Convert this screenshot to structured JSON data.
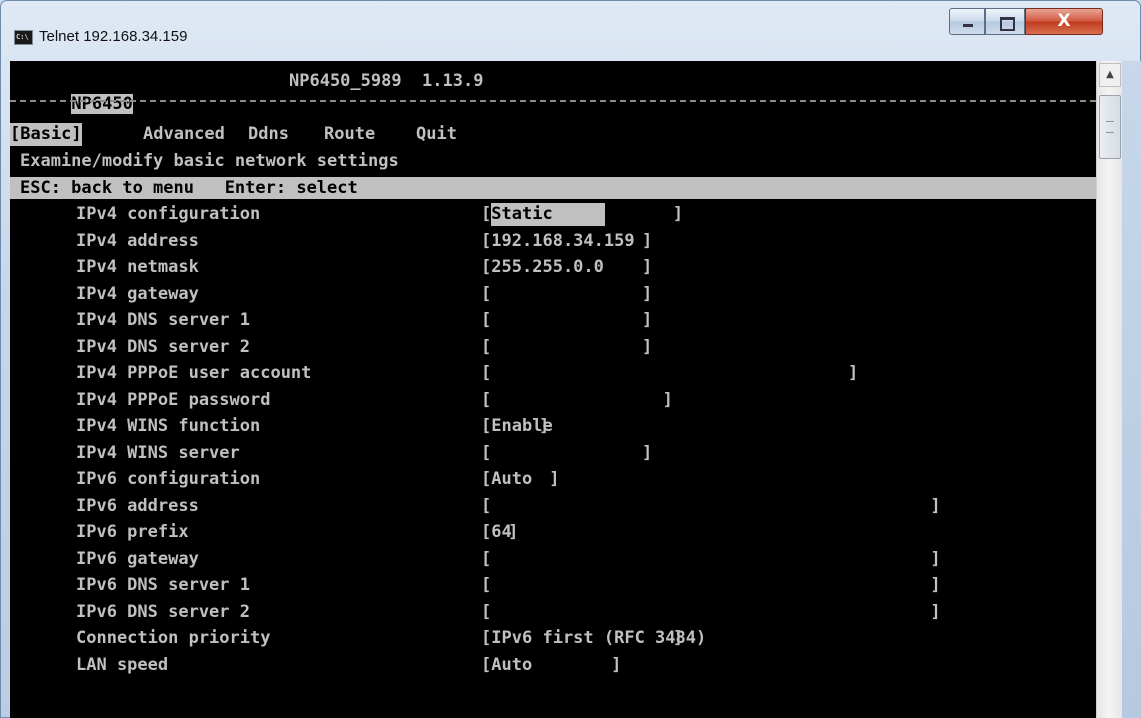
{
  "window": {
    "title": "Telnet 192.168.34.159",
    "icon_label": "C:\\",
    "close_symbol": "X"
  },
  "header": {
    "model": "NP6450",
    "name_version": "NP6450_5989  1.13.9"
  },
  "menu": {
    "items": [
      {
        "label": "[Basic]",
        "selected": true
      },
      {
        "label": "Advanced",
        "selected": false
      },
      {
        "label": "Ddns",
        "selected": false
      },
      {
        "label": "Route",
        "selected": false
      },
      {
        "label": "Quit",
        "selected": false
      }
    ],
    "description": "Examine/modify basic network settings"
  },
  "status": {
    "text": "ESC: back to menu   Enter: select"
  },
  "settings": [
    {
      "label": "IPv4 configuration",
      "value": "Static",
      "close_col": 63
    },
    {
      "label": "IPv4 address",
      "value": "192.168.34.159 ",
      "close_col": 60
    },
    {
      "label": "IPv4 netmask",
      "value": "255.255.0.0",
      "close_col": 60
    },
    {
      "label": "IPv4 gateway",
      "value": "",
      "close_col": 60
    },
    {
      "label": "IPv4 DNS server 1",
      "value": "",
      "close_col": 60
    },
    {
      "label": "IPv4 DNS server 2",
      "value": "",
      "close_col": 60
    },
    {
      "label": "IPv4 PPPoE user account",
      "value": "",
      "close_col": 80
    },
    {
      "label": "IPv4 PPPoE password",
      "value": "",
      "close_col": 62
    },
    {
      "label": "IPv4 WINS function",
      "value": "Enable ",
      "close_col": 50
    },
    {
      "label": "IPv4 WINS server",
      "value": "",
      "close_col": 60
    },
    {
      "label": "IPv6 configuration",
      "value": "Auto",
      "close_col": 51
    },
    {
      "label": "IPv6 address",
      "value": "",
      "close_col": 88
    },
    {
      "label": "IPv6 prefix",
      "value": "64 ",
      "close_col": 47
    },
    {
      "label": "IPv6 gateway",
      "value": "",
      "close_col": 88
    },
    {
      "label": "IPv6 DNS server 1",
      "value": "",
      "close_col": 88
    },
    {
      "label": "IPv6 DNS server 2",
      "value": "",
      "close_col": 88
    },
    {
      "label": "Connection priority",
      "value": "IPv6 first (RFC 3484)",
      "close_col": 63
    },
    {
      "label": "LAN speed",
      "value": "Auto",
      "close_col": 57
    }
  ]
}
